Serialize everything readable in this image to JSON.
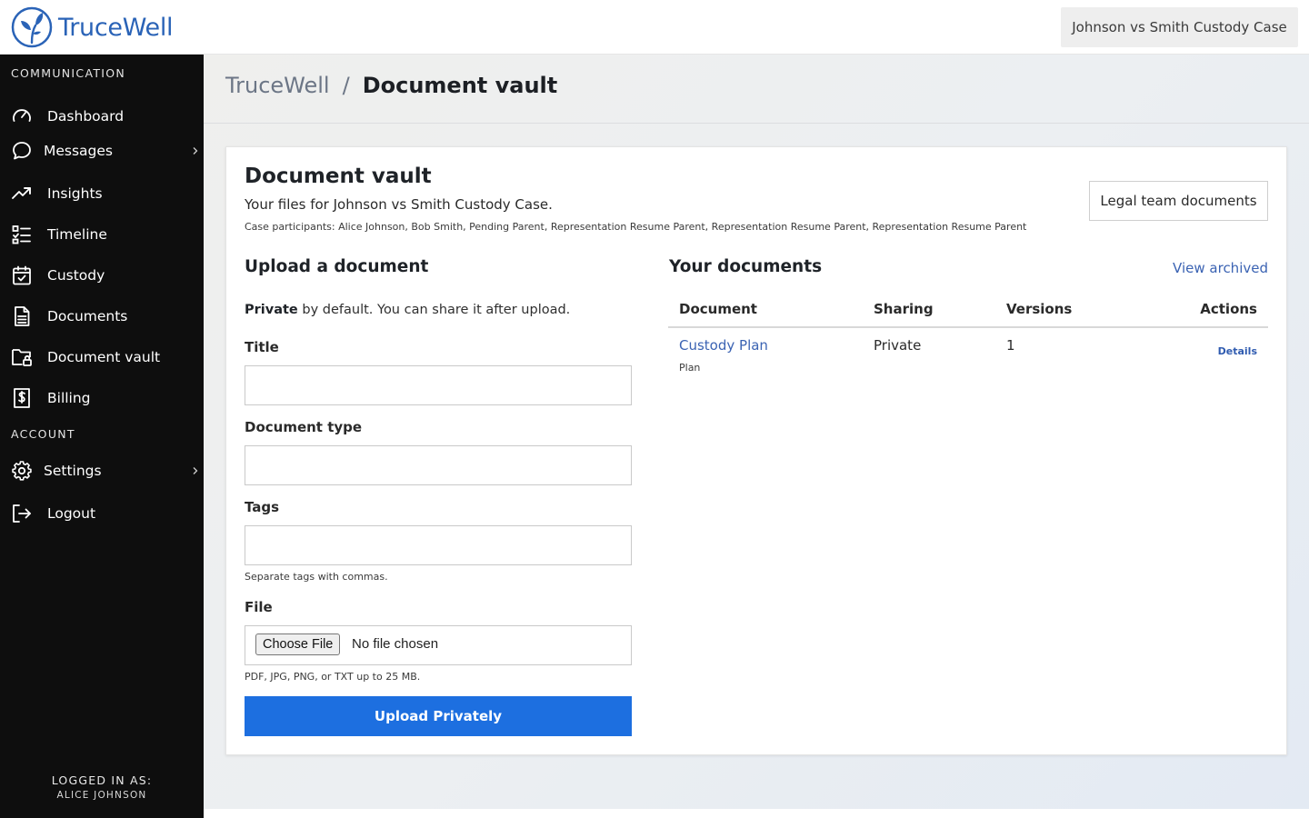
{
  "header": {
    "brand": "TruceWell",
    "case_selector": "Johnson vs Smith Custody Case"
  },
  "sidebar": {
    "sections": [
      {
        "title": "COMMUNICATION",
        "items": [
          {
            "label": "Dashboard",
            "icon": "gauge-icon"
          },
          {
            "label": "Messages",
            "icon": "chat-bubble-icon",
            "has_submenu": true
          },
          {
            "label": "Insights",
            "icon": "trending-up-icon"
          },
          {
            "label": "Timeline",
            "icon": "checklist-icon"
          },
          {
            "label": "Custody",
            "icon": "calendar-check-icon"
          },
          {
            "label": "Documents",
            "icon": "document-icon"
          },
          {
            "label": "Document vault",
            "icon": "folder-lock-icon"
          },
          {
            "label": "Billing",
            "icon": "invoice-dollar-icon"
          }
        ]
      },
      {
        "title": "ACCOUNT",
        "items": [
          {
            "label": "Settings",
            "icon": "gear-icon",
            "has_submenu": true
          },
          {
            "label": "Logout",
            "icon": "logout-icon"
          }
        ]
      }
    ],
    "logged_in_label": "LOGGED IN AS:",
    "logged_in_user": "ALICE JOHNSON"
  },
  "breadcrumb": {
    "home": "TruceWell",
    "separator": "/",
    "current": "Document vault"
  },
  "vault": {
    "title": "Document vault",
    "subtitle": "Your files for Johnson vs Smith Custody Case.",
    "participants": "Case participants: Alice Johnson, Bob Smith, Pending Parent, Representation Resume Parent, Representation Resume Parent, Representation Resume Parent",
    "legal_button": "Legal team documents"
  },
  "upload": {
    "heading": "Upload a document",
    "note_bold": "Private",
    "note_rest": " by default. You can share it after upload.",
    "title_label": "Title",
    "title_value": "",
    "type_label": "Document type",
    "type_value": "",
    "tags_label": "Tags",
    "tags_value": "",
    "tags_help": "Separate tags with commas.",
    "file_label": "File",
    "file_button": "Choose File",
    "file_status": "No file chosen",
    "file_help": "PDF, JPG, PNG, or TXT up to 25 MB.",
    "submit": "Upload Privately"
  },
  "documents": {
    "heading": "Your documents",
    "view_archived": "View archived",
    "columns": [
      "Document",
      "Sharing",
      "Versions",
      "Actions"
    ],
    "rows": [
      {
        "name": "Custody Plan",
        "type": "Plan",
        "sharing": "Private",
        "versions": "1",
        "action": "Details"
      }
    ]
  },
  "colors": {
    "brand": "#2a63b7",
    "sidebar_bg": "#0e0e0e",
    "primary_button": "#1d6fe0",
    "link": "#3b63b3"
  }
}
